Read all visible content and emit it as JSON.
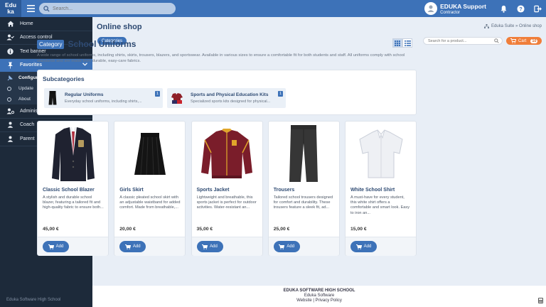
{
  "app": {
    "logo_line1": "Edu",
    "logo_line2": "ka"
  },
  "topbar": {
    "search_placeholder": "Search...",
    "user_name": "EDUKA Support",
    "user_role": "Contractor"
  },
  "sidebar": {
    "items": [
      {
        "label": "Home",
        "icon": "home-icon"
      },
      {
        "label": "Access control",
        "icon": "user-check-icon"
      },
      {
        "label": "Text banner",
        "icon": "info-icon"
      },
      {
        "label": "Favorites",
        "icon": "pin-icon"
      }
    ],
    "submenu": [
      {
        "label": "Configuration"
      },
      {
        "label": "Update"
      },
      {
        "label": "About"
      }
    ],
    "groups": [
      {
        "label": "Administrator",
        "icon": "users-gear-icon"
      },
      {
        "label": "Coach",
        "icon": "user-icon"
      },
      {
        "label": "Parent",
        "icon": "person-icon"
      }
    ],
    "footer": "Eduka Software High School"
  },
  "main": {
    "title": "Online shop",
    "breadcrumb": "Eduka Suite » Online shop",
    "categories_button": "Categories",
    "search_placeholder": "Search for a product...",
    "cart_label": "Cart",
    "cart_count": "10"
  },
  "category": {
    "tag": "Category",
    "name": "School Uniforms",
    "description": "A wide range of school uniforms, including shirts, skirts, trousers, blazers, and sportswear. Available in various sizes to ensure a comfortable fit for both students and staff. All uniforms comply with school standards and are made from durable, easy-care fabrics."
  },
  "subcategories": {
    "title": "Subcategories",
    "items": [
      {
        "name": "Regular Uniforms",
        "desc": "Everyday school uniforms, including shirts,...",
        "count": "1"
      },
      {
        "name": "Sports and Physical Education Kits",
        "desc": "Specialized sports kits designed for physical...",
        "count": "1"
      }
    ]
  },
  "products": [
    {
      "name": "Classic School Blazer",
      "desc": "A stylish and durable school blazer, featuring a tailored fit and high-quality fabric to ensure both...",
      "price": "45,00 €",
      "add": "Add"
    },
    {
      "name": "Girls Skirt",
      "desc": "A classic pleated school skirt with an adjustable waistband for added comfort. Made from breathable,...",
      "price": "20,00 €",
      "add": "Add"
    },
    {
      "name": "Sports Jacket",
      "desc": "Lightweight and breathable, this sports jacket is perfect for outdoor activities. Water-resistant an...",
      "price": "35,00 €",
      "add": "Add"
    },
    {
      "name": "Trousers",
      "desc": "Tailored school trousers designed for comfort and durability. These trousers feature a sleek fit, ad...",
      "price": "25,00 €",
      "add": "Add"
    },
    {
      "name": "White School Shirt",
      "desc": "A must-have for every student, this white shirt offers a comfortable and smart look. Easy to iron an...",
      "price": "15,00 €",
      "add": "Add"
    }
  ],
  "footer": {
    "school": "EDUKA SOFTWARE HIGH SCHOOL",
    "company": "Eduka Software",
    "links": "Website | Privacy Policy"
  },
  "colors": {
    "primary": "#3d72b8",
    "sidebar": "#1d2a3a",
    "accent": "#f07e3a",
    "background": "#e8eef6"
  }
}
